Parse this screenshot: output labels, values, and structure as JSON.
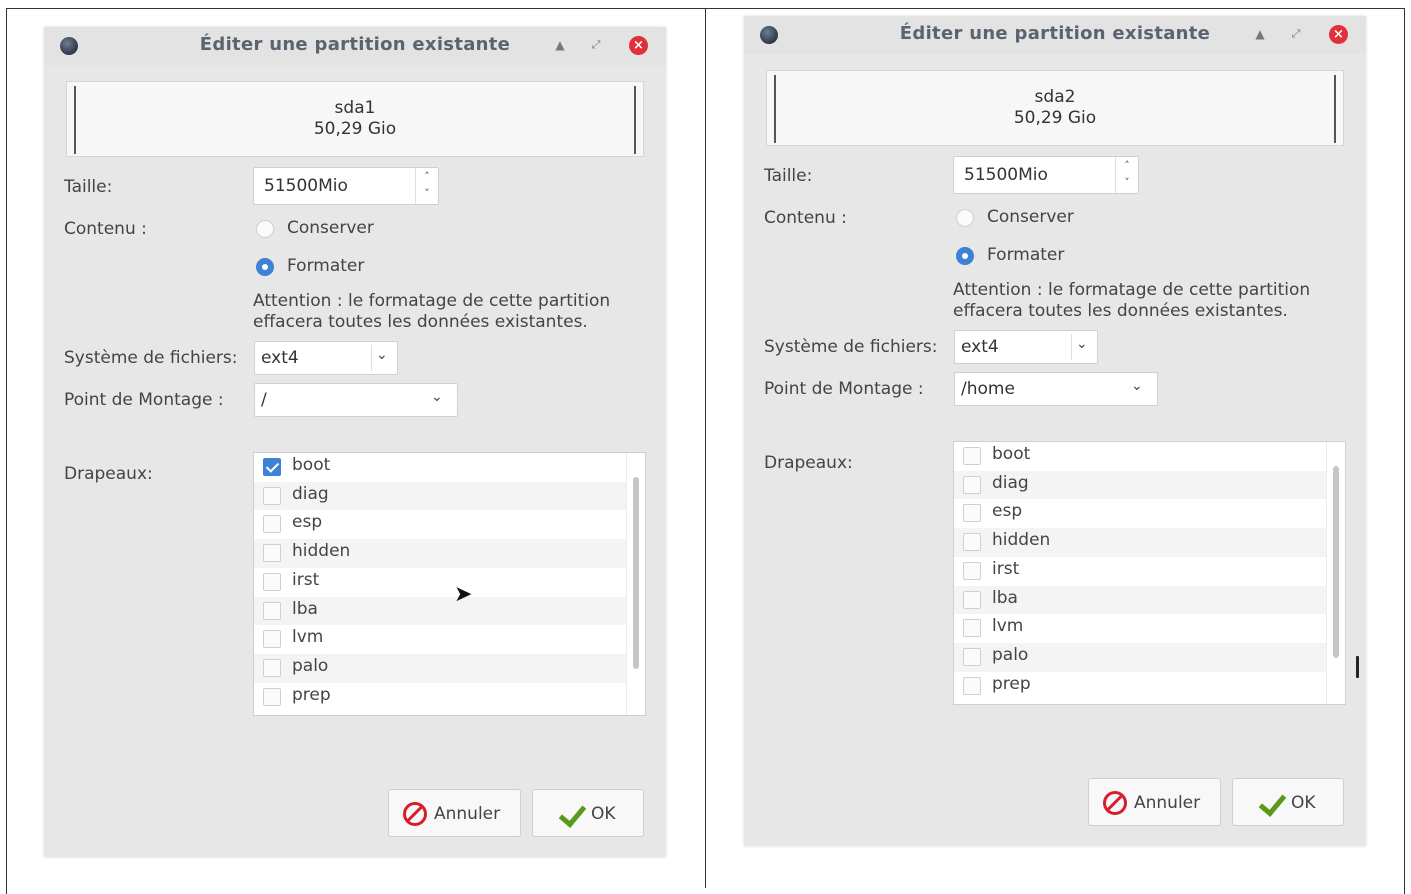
{
  "dialogs": [
    {
      "title": "Éditer une partition existante",
      "partition": {
        "name": "sda1",
        "size": "50,29 Gio"
      },
      "size_label": "Taille:",
      "size_value": "51500Mio",
      "content_label": "Contenu :",
      "keep_label": "Conserver",
      "format_label": "Formater",
      "selected_content": "Formater",
      "warning_line1": "Attention : le formatage de cette partition",
      "warning_line2": "effacera toutes les données existantes.",
      "fs_label": "Système de fichiers:",
      "fs_value": "ext4",
      "mount_label": "Point de Montage :",
      "mount_value": "/",
      "flags_label": "Drapeaux:",
      "flags": [
        {
          "name": "boot",
          "checked": true
        },
        {
          "name": "diag",
          "checked": false
        },
        {
          "name": "esp",
          "checked": false
        },
        {
          "name": "hidden",
          "checked": false
        },
        {
          "name": "irst",
          "checked": false
        },
        {
          "name": "lba",
          "checked": false
        },
        {
          "name": "lvm",
          "checked": false
        },
        {
          "name": "palo",
          "checked": false
        },
        {
          "name": "prep",
          "checked": false
        }
      ],
      "cancel_label": "Annuler",
      "ok_label": "OK"
    },
    {
      "title": "Éditer une partition existante",
      "partition": {
        "name": "sda2",
        "size": "50,29 Gio"
      },
      "size_label": "Taille:",
      "size_value": "51500Mio",
      "content_label": "Contenu :",
      "keep_label": "Conserver",
      "format_label": "Formater",
      "selected_content": "Formater",
      "warning_line1": "Attention : le formatage de cette partition",
      "warning_line2": "effacera toutes les données existantes.",
      "fs_label": "Système de fichiers:",
      "fs_value": "ext4",
      "mount_label": "Point de Montage :",
      "mount_value": "/home",
      "flags_label": "Drapeaux:",
      "flags": [
        {
          "name": "boot",
          "checked": false
        },
        {
          "name": "diag",
          "checked": false
        },
        {
          "name": "esp",
          "checked": false
        },
        {
          "name": "hidden",
          "checked": false
        },
        {
          "name": "irst",
          "checked": false
        },
        {
          "name": "lba",
          "checked": false
        },
        {
          "name": "lvm",
          "checked": false
        },
        {
          "name": "palo",
          "checked": false
        },
        {
          "name": "prep",
          "checked": false
        }
      ],
      "cancel_label": "Annuler",
      "ok_label": "OK"
    }
  ],
  "icons": {
    "app": "app-icon",
    "minimize": "minimize-icon",
    "maximize": "maximize-icon",
    "close": "close-icon",
    "cancel": "cancel-icon",
    "ok": "checkmark-icon"
  },
  "colors": {
    "accent": "#3e82d4",
    "close": "#e0303a",
    "cancel": "#d81e2c",
    "ok": "#5a9a1a"
  }
}
